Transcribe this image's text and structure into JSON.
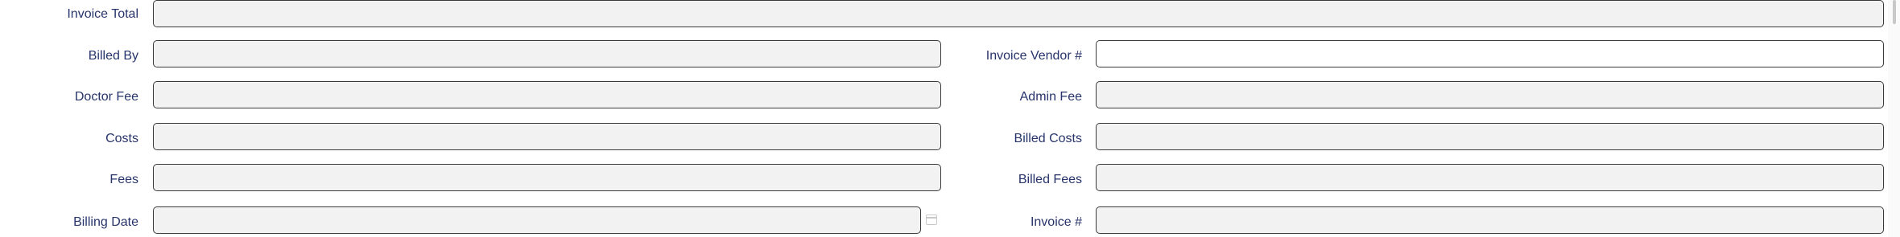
{
  "form": {
    "invoice_total": {
      "label": "Invoice Total",
      "value": ""
    },
    "billed_by": {
      "label": "Billed By",
      "value": ""
    },
    "invoice_vendor_no": {
      "label": "Invoice Vendor #",
      "value": ""
    },
    "doctor_fee": {
      "label": "Doctor Fee",
      "value": ""
    },
    "admin_fee": {
      "label": "Admin Fee",
      "value": ""
    },
    "costs": {
      "label": "Costs",
      "value": ""
    },
    "billed_costs": {
      "label": "Billed Costs",
      "value": ""
    },
    "fees": {
      "label": "Fees",
      "value": ""
    },
    "billed_fees": {
      "label": "Billed Fees",
      "value": ""
    },
    "billing_date": {
      "label": "Billing Date",
      "value": "",
      "icon": "calendar-icon"
    },
    "invoice_no": {
      "label": "Invoice #",
      "value": ""
    }
  },
  "colors": {
    "label": "#27346b",
    "readonly_bg": "#f2f2f2",
    "editable_bg": "#ffffff",
    "border": "#3a3a3a"
  }
}
